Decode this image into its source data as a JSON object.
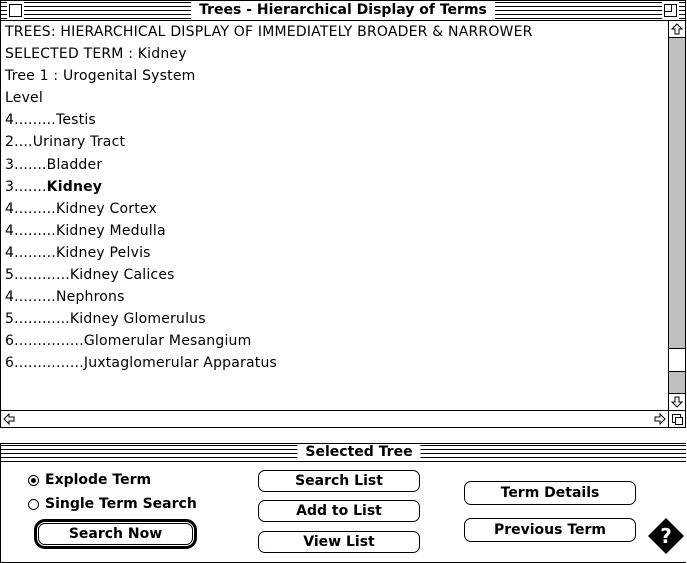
{
  "trees_window": {
    "title": "Trees - Hierarchical Display of Terms",
    "lines": [
      {
        "text": "TREES:  HIERARCHICAL DISPLAY OF IMMEDIATELY BROADER & NARROWER",
        "bold": false
      },
      {
        "text": "SELECTED TERM : Kidney",
        "bold": false
      },
      {
        "text": "Tree 1 : Urogenital System",
        "bold": false
      },
      {
        "text": "Level",
        "bold": false
      },
      {
        "text": "4.........Testis",
        "bold": false
      },
      {
        "text": "2....Urinary Tract",
        "bold": false
      },
      {
        "text": "3.......Bladder",
        "bold": false
      },
      {
        "prefix": "3.......",
        "text": "Kidney",
        "bold": true
      },
      {
        "text": "4.........Kidney Cortex",
        "bold": false
      },
      {
        "text": "4.........Kidney Medulla",
        "bold": false
      },
      {
        "text": "4.........Kidney Pelvis",
        "bold": false
      },
      {
        "text": "5............Kidney Calices",
        "bold": false
      },
      {
        "text": "4.........Nephrons",
        "bold": false
      },
      {
        "text": "5............Kidney Glomerulus",
        "bold": false
      },
      {
        "text": "6...............Glomerular Mesangium",
        "bold": false
      },
      {
        "text": "6...............Juxtaglomerular Apparatus",
        "bold": false
      }
    ],
    "icons": {
      "close": "close-box",
      "zoom": "zoom-box",
      "scroll_up": "up-arrow-icon",
      "scroll_down": "down-arrow-icon",
      "scroll_left": "left-arrow-icon",
      "scroll_right": "right-arrow-icon",
      "grow": "grow-box"
    }
  },
  "selected_tree_window": {
    "title": "Selected Tree",
    "radios": [
      {
        "label": "Explode Term",
        "checked": true
      },
      {
        "label": "Single Term Search",
        "checked": false
      }
    ],
    "buttons": {
      "search_now": "Search Now",
      "search_list": "Search List",
      "add_to_list": "Add to List",
      "view_list": "View List",
      "term_details": "Term Details",
      "previous_term": "Previous Term"
    },
    "help_icon": "help-diamond-icon"
  }
}
